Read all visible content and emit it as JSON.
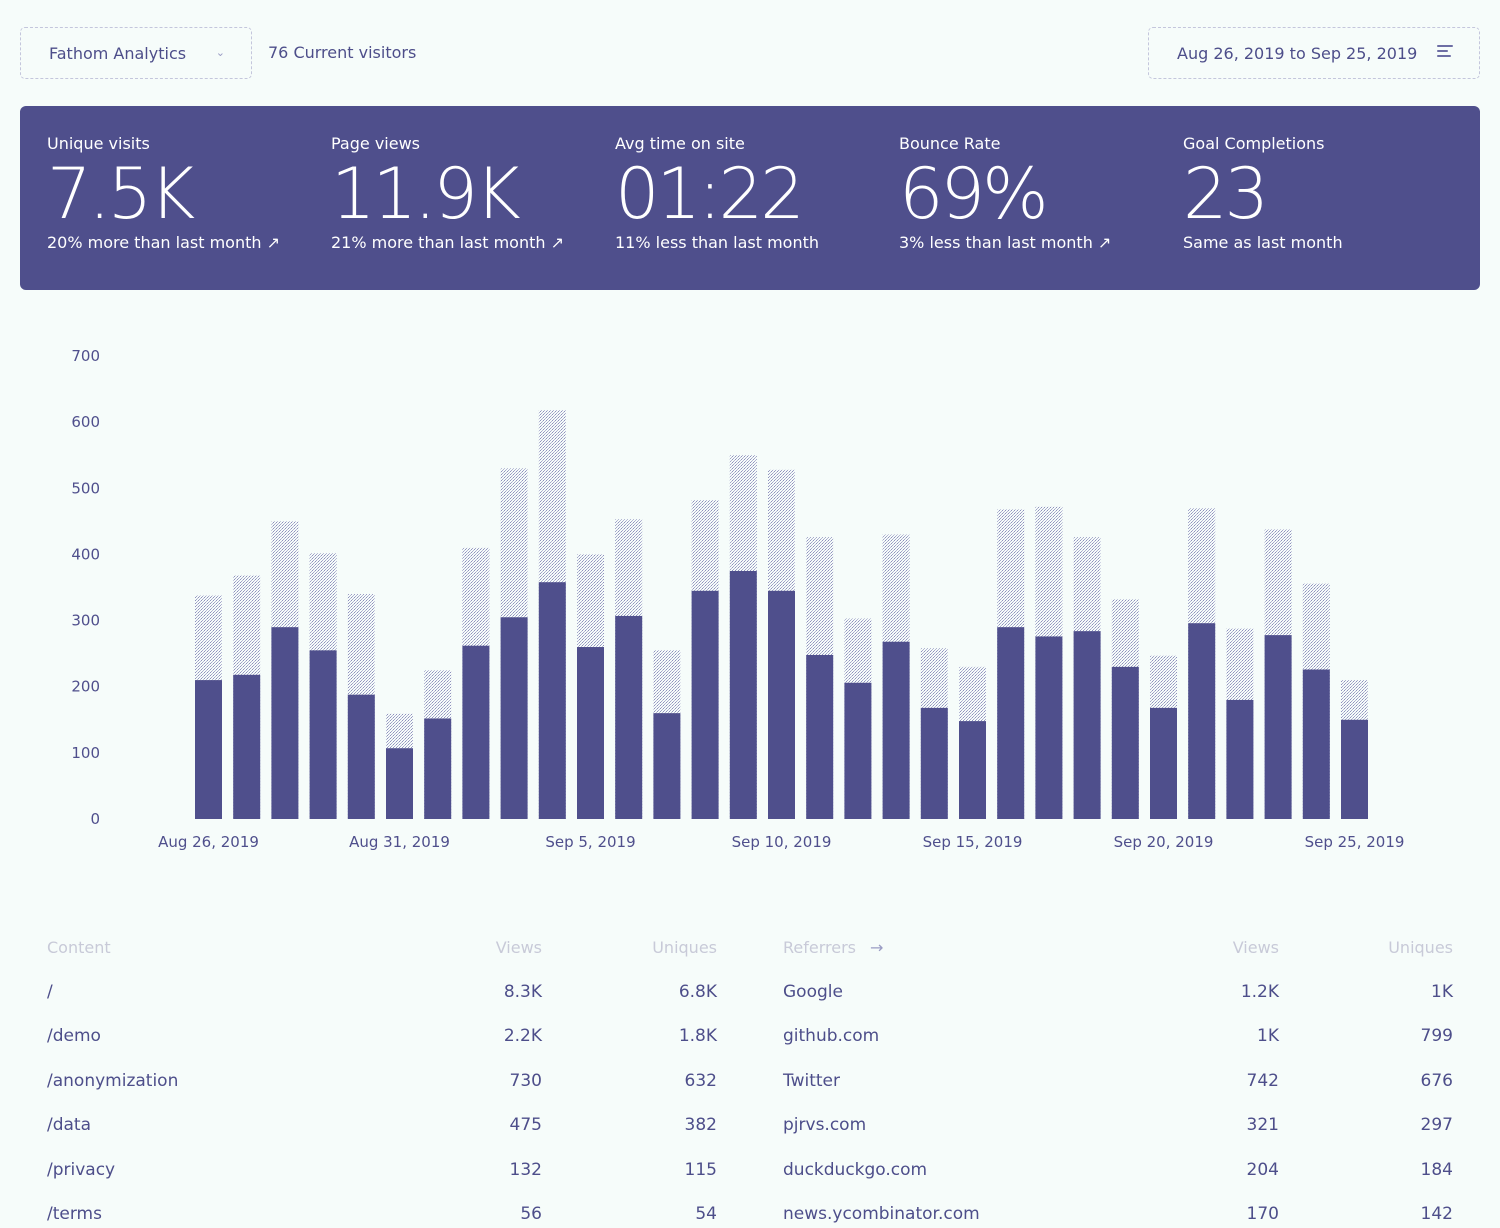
{
  "topbar": {
    "site_name": "Fathom Analytics",
    "site_caret": "⌄",
    "current_visitors": "76 Current visitors",
    "date_range": "Aug 26, 2019 to Sep 25, 2019",
    "date_icon": "sort-icon"
  },
  "stats": [
    {
      "label": "Unique visits",
      "value": "7.5K",
      "change": "20% more than last month ↗"
    },
    {
      "label": "Page views",
      "value": "11.9K",
      "change": "21% more than last month ↗"
    },
    {
      "label": "Avg time on site",
      "value": "01:22",
      "change": "11% less than last month"
    },
    {
      "label": "Bounce Rate",
      "value": "69%",
      "change": "3% less than last month ↗"
    },
    {
      "label": "Goal Completions",
      "value": "23",
      "change": "Same as last month"
    }
  ],
  "colors": {
    "accent": "#4f4f8c",
    "background": "#f6fcfa",
    "pageview_bar_hatch": "#9a9cc4"
  },
  "chart_data": {
    "type": "bar",
    "stacked": "overlay",
    "ylim": [
      0,
      700
    ],
    "yticks": [
      "700",
      "600",
      "500",
      "400",
      "300",
      "200",
      "100",
      "0"
    ],
    "xtick_labels": [
      "Aug 26, 2019",
      "Aug 31, 2019",
      "Sep 5, 2019",
      "Sep 10, 2019",
      "Sep 15, 2019",
      "Sep 20, 2019",
      "Sep 25, 2019"
    ],
    "categories": [
      "Aug 26",
      "Aug 27",
      "Aug 28",
      "Aug 29",
      "Aug 30",
      "Aug 31",
      "Sep 1",
      "Sep 2",
      "Sep 3",
      "Sep 4",
      "Sep 5",
      "Sep 6",
      "Sep 7",
      "Sep 8",
      "Sep 9",
      "Sep 10",
      "Sep 11",
      "Sep 12",
      "Sep 13",
      "Sep 14",
      "Sep 15",
      "Sep 16",
      "Sep 17",
      "Sep 18",
      "Sep 19",
      "Sep 20",
      "Sep 21",
      "Sep 22",
      "Sep 23",
      "Sep 24",
      "Sep 25"
    ],
    "series": [
      {
        "values": [
          210,
          218,
          290,
          255,
          188,
          107,
          152,
          262,
          305,
          358,
          260,
          307,
          160,
          345,
          375,
          345,
          248,
          206,
          268,
          168,
          148,
          290,
          276,
          284,
          230,
          168,
          296,
          180,
          278,
          226,
          150
        ]
      },
      {
        "values": [
          338,
          368,
          450,
          402,
          340,
          159,
          225,
          410,
          530,
          618,
          400,
          453,
          255,
          482,
          550,
          528,
          426,
          303,
          430,
          258,
          230,
          468,
          472,
          426,
          332,
          247,
          470,
          288,
          438,
          356,
          210
        ]
      }
    ],
    "grid": false,
    "legend": "none"
  },
  "content_table": {
    "headers": {
      "content": "Content",
      "views": "Views",
      "uniques": "Uniques"
    },
    "rows": [
      {
        "path": "/",
        "views": "8.3K",
        "uniques": "6.8K"
      },
      {
        "path": "/demo",
        "views": "2.2K",
        "uniques": "1.8K"
      },
      {
        "path": "/anonymization",
        "views": "730",
        "uniques": "632"
      },
      {
        "path": "/data",
        "views": "475",
        "uniques": "382"
      },
      {
        "path": "/privacy",
        "views": "132",
        "uniques": "115"
      },
      {
        "path": "/terms",
        "views": "56",
        "uniques": "54"
      }
    ]
  },
  "referrer_table": {
    "headers": {
      "referrers": "Referrers",
      "arrow": "→",
      "views": "Views",
      "uniques": "Uniques"
    },
    "rows": [
      {
        "source": "Google",
        "views": "1.2K",
        "uniques": "1K"
      },
      {
        "source": "github.com",
        "views": "1K",
        "uniques": "799"
      },
      {
        "source": "Twitter",
        "views": "742",
        "uniques": "676"
      },
      {
        "source": "pjrvs.com",
        "views": "321",
        "uniques": "297"
      },
      {
        "source": "duckduckgo.com",
        "views": "204",
        "uniques": "184"
      },
      {
        "source": "news.ycombinator.com",
        "views": "170",
        "uniques": "142"
      }
    ]
  }
}
